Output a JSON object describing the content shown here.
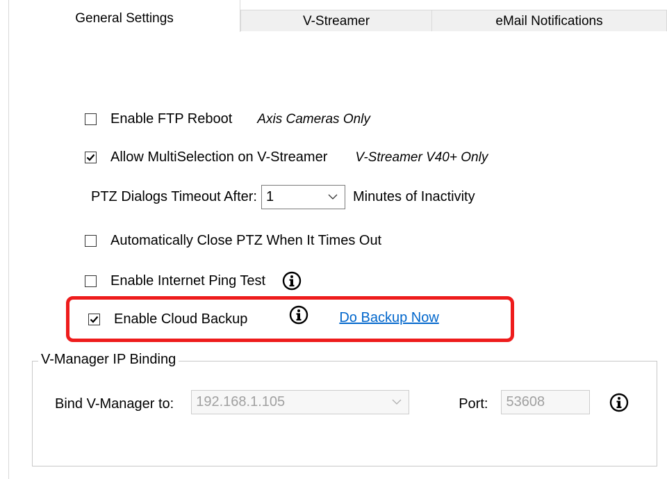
{
  "tabs": [
    {
      "label": "General Settings",
      "active": true
    },
    {
      "label": "V-Streamer",
      "active": false
    },
    {
      "label": "eMail Notifications",
      "active": false
    }
  ],
  "settings": {
    "ftp_reboot": {
      "label": "Enable FTP Reboot",
      "note": "Axis Cameras Only",
      "checked": false
    },
    "multiselection": {
      "label": "Allow MultiSelection on V-Streamer",
      "note": "V-Streamer V40+ Only",
      "checked": true
    },
    "ptz_timeout": {
      "label": "PTZ Dialogs Timeout After:",
      "value": "1",
      "suffix": "Minutes of Inactivity"
    },
    "auto_close_ptz": {
      "label": "Automatically Close PTZ When It Times Out",
      "checked": false
    },
    "ping_test": {
      "label": "Enable Internet Ping Test",
      "checked": false
    },
    "cloud_backup": {
      "label": "Enable Cloud Backup",
      "checked": true,
      "link": "Do Backup Now"
    }
  },
  "ip_binding": {
    "title": "V-Manager IP Binding",
    "bind_label": "Bind V-Manager to:",
    "bind_value": "192.168.1.105",
    "port_label": "Port:",
    "port_value": "53608"
  },
  "colors": {
    "highlight": "#ee1c1c",
    "link": "#0066cc",
    "tab_inactive_bg": "#f0f0f0"
  },
  "icons": [
    "checkmark-icon",
    "chevron-down-icon",
    "info-icon"
  ]
}
